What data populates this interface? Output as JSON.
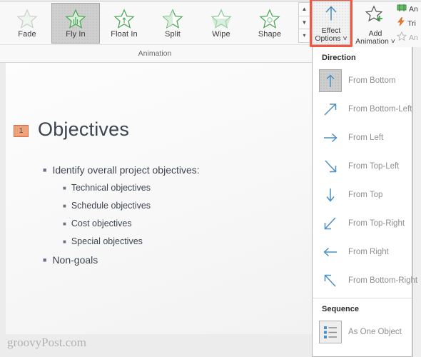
{
  "ribbon": {
    "group_label": "Animation",
    "gallery": [
      {
        "label": "Fade",
        "icon": "star-icon",
        "selected": false
      },
      {
        "label": "Fly In",
        "icon": "star-icon",
        "selected": true
      },
      {
        "label": "Float In",
        "icon": "star-icon",
        "selected": false
      },
      {
        "label": "Split",
        "icon": "star-icon",
        "selected": false
      },
      {
        "label": "Wipe",
        "icon": "star-icon",
        "selected": false
      },
      {
        "label": "Shape",
        "icon": "star-icon",
        "selected": false
      }
    ],
    "scroll": {
      "up": "▲",
      "down": "▼",
      "more": "▾"
    },
    "effect_options": {
      "label_line1": "Effect",
      "label_line2": "Options",
      "chevron": "˅",
      "icon": "up-arrow-icon",
      "highlight_color": "#f4573f",
      "active": true
    },
    "add_animation": {
      "label_line1": "Add",
      "label_line2": "Animation",
      "chevron": "˅",
      "icon": "star-plus-icon"
    },
    "right_items": [
      {
        "label": "An",
        "icon": "animation-pane-icon",
        "color": "#4ea24e",
        "dim": false
      },
      {
        "label": "Tri",
        "icon": "trigger-lightning-icon",
        "color": "#e8762c",
        "dim": false
      },
      {
        "label": "An",
        "icon": "animation-painter-star-icon",
        "color": "#b9b9b9",
        "dim": true
      }
    ]
  },
  "slide": {
    "animation_badge": "1",
    "title": "Objectives",
    "bullets": [
      {
        "level": 1,
        "text": "Identify overall project objectives:"
      },
      {
        "level": 2,
        "text": "Technical objectives"
      },
      {
        "level": 2,
        "text": "Schedule objectives"
      },
      {
        "level": 2,
        "text": "Cost objectives"
      },
      {
        "level": 2,
        "text": "Special objectives"
      },
      {
        "level": 1,
        "text": "Non-goals"
      }
    ],
    "watermark": "groovyPost.com"
  },
  "panel": {
    "direction_header": "Direction",
    "directions": [
      {
        "label": "From Bottom",
        "accesskey": "B",
        "icon": "arrow-up-icon",
        "selected": true
      },
      {
        "label": "From Bottom-Left",
        "accesskey": "f",
        "icon": "arrow-up-right-icon",
        "selected": false
      },
      {
        "label": "From Left",
        "accesskey": "L",
        "icon": "arrow-right-icon",
        "selected": false
      },
      {
        "label": "From Top-Left",
        "accesskey": "f",
        "icon": "arrow-down-right-icon",
        "selected": false
      },
      {
        "label": "From Top",
        "accesskey": "T",
        "icon": "arrow-down-icon",
        "selected": false
      },
      {
        "label": "From Top-Right",
        "accesskey": "g",
        "icon": "arrow-down-left-icon",
        "selected": false
      },
      {
        "label": "From Right",
        "accesskey": "R",
        "icon": "arrow-left-icon",
        "selected": false
      },
      {
        "label": "From Bottom-Right",
        "accesskey": "g",
        "icon": "arrow-up-left-icon",
        "selected": false
      }
    ],
    "sequence_header": "Sequence",
    "sequence": [
      {
        "label": "As One Object",
        "accesskey": "n",
        "icon": "list-lines-icon",
        "selected": false
      }
    ],
    "arrow_color": "#4a90c4"
  }
}
